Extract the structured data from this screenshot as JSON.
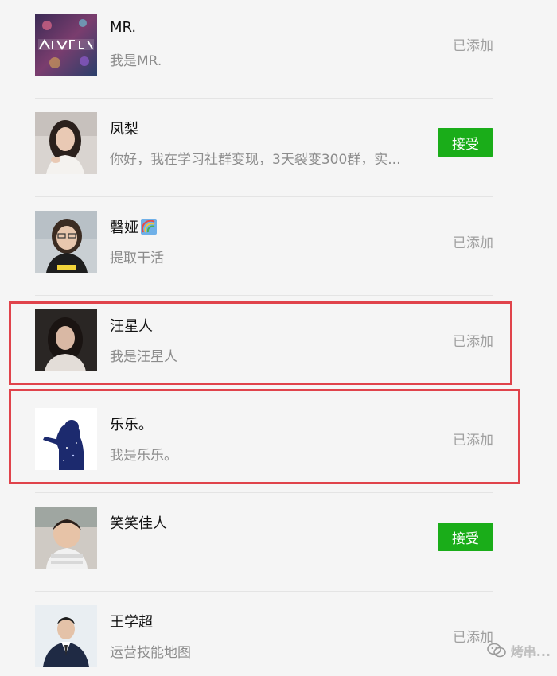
{
  "contacts": [
    {
      "name": "MR.",
      "message": "我是MR.",
      "status": "已添加"
    },
    {
      "name": "凤梨",
      "message": "你好，我在学习社群变现，3天裂变300群，实...",
      "button": "接受"
    },
    {
      "name": "磬娅",
      "message": "提取干活",
      "status": "已添加"
    },
    {
      "name": "汪星人",
      "message": "我是汪星人",
      "status": "已添加"
    },
    {
      "name": "乐乐。",
      "message": "我是乐乐。",
      "status": "已添加"
    },
    {
      "name": "笑笑佳人",
      "message": "",
      "button": "接受"
    },
    {
      "name": "王学超",
      "message": "运营技能地图",
      "status": "已添加"
    }
  ],
  "watermark": {
    "text": "烤串...",
    "icon": "wechat-official-account-icon"
  },
  "colors": {
    "accept_green": "#1aad19",
    "highlight_red": "#e0434b",
    "status_gray": "#a0a0a0",
    "background": "#f5f5f5"
  }
}
